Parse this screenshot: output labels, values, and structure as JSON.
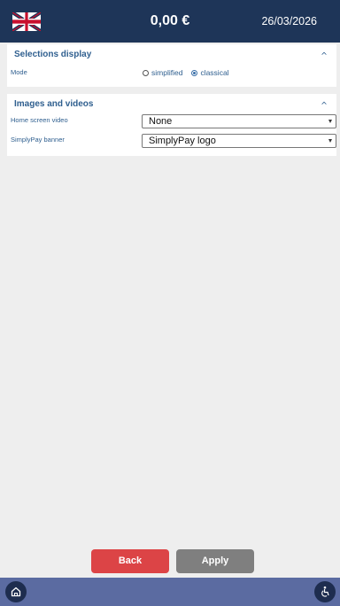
{
  "header": {
    "flag_icon": "uk-flag-icon",
    "amount": "0,00 €",
    "date": "26/03/2026"
  },
  "selections_display": {
    "title": "Selections display",
    "mode_label": "Mode",
    "options": [
      {
        "label": "simplified",
        "selected": false
      },
      {
        "label": "classical",
        "selected": true
      }
    ]
  },
  "images_videos": {
    "title": "Images and videos",
    "home_video_label": "Home screen video",
    "home_video_value": "None",
    "banner_label": "SimplyPay banner",
    "banner_value": "SimplyPay logo"
  },
  "actions": {
    "back_label": "Back",
    "apply_label": "Apply"
  },
  "footer": {
    "home_icon": "home-icon",
    "accessibility_icon": "accessibility-icon"
  },
  "colors": {
    "header_bg": "#1e3558",
    "footer_bg": "#5b6ba1",
    "accent_text": "#2f5f8f",
    "back_button": "#dc4446",
    "apply_button": "#7f7f7f"
  }
}
